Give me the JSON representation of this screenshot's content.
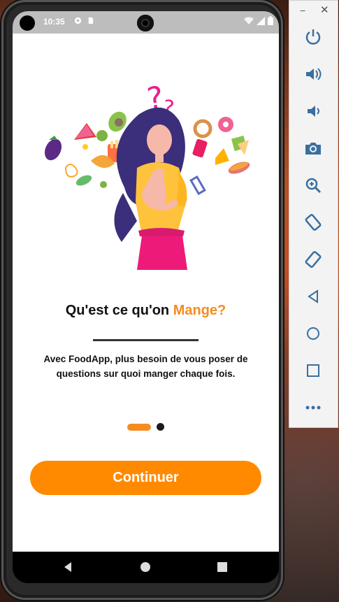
{
  "status_bar": {
    "time": "10:35"
  },
  "onboarding": {
    "title_prefix": "Qu'est ce qu'on ",
    "title_accent": "Mange?",
    "description": "Avec FoodApp, plus besoin de vous poser de questions sur quoi manger chaque fois.",
    "pagination": {
      "active_index": 0,
      "total": 2
    },
    "cta_label": "Continuer"
  },
  "colors": {
    "accent": "#ff8a00",
    "title_accent": "#f68b1f",
    "status_bar": "#bdbdbd"
  },
  "emulator_toolbar": {
    "window_controls": [
      "minimize-icon",
      "close-icon"
    ],
    "buttons": [
      "power-icon",
      "volume-up-icon",
      "volume-down-icon",
      "camera-icon",
      "zoom-icon",
      "rotate-left-icon",
      "rotate-right-icon",
      "back-icon",
      "home-icon",
      "overview-icon",
      "more-icon"
    ]
  }
}
